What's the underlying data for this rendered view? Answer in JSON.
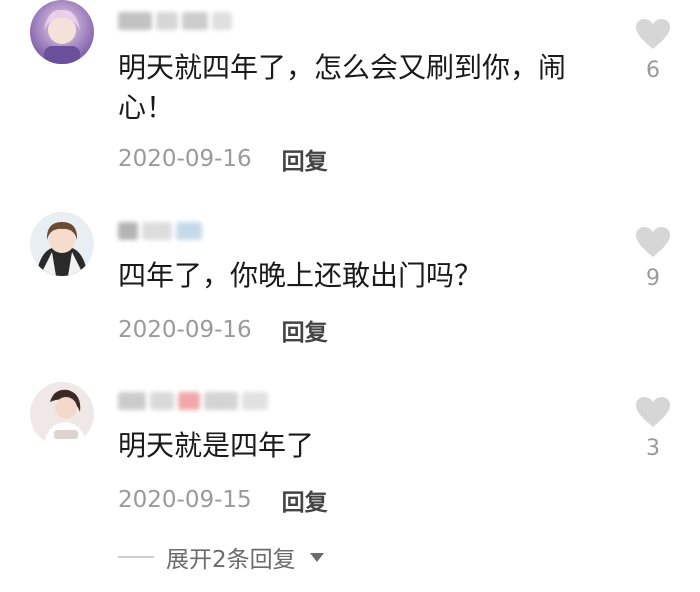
{
  "comments": [
    {
      "text": "明天就四年了，怎么会又刷到你，闹心！",
      "date": "2020-09-16",
      "reply": "回复",
      "likes": "6"
    },
    {
      "text": "四年了，你晚上还敢出门吗？",
      "date": "2020-09-16",
      "reply": "回复",
      "likes": "9"
    },
    {
      "text": "明天就是四年了",
      "date": "2020-09-15",
      "reply": "回复",
      "likes": "3"
    }
  ],
  "expand_label": "展开2条回复",
  "icons": {
    "like": "heart-icon",
    "expand": "caret-down-icon"
  },
  "colors": {
    "text": "#1a1a1a",
    "meta": "#9a9a9a",
    "heart": "#d6d6d6"
  }
}
